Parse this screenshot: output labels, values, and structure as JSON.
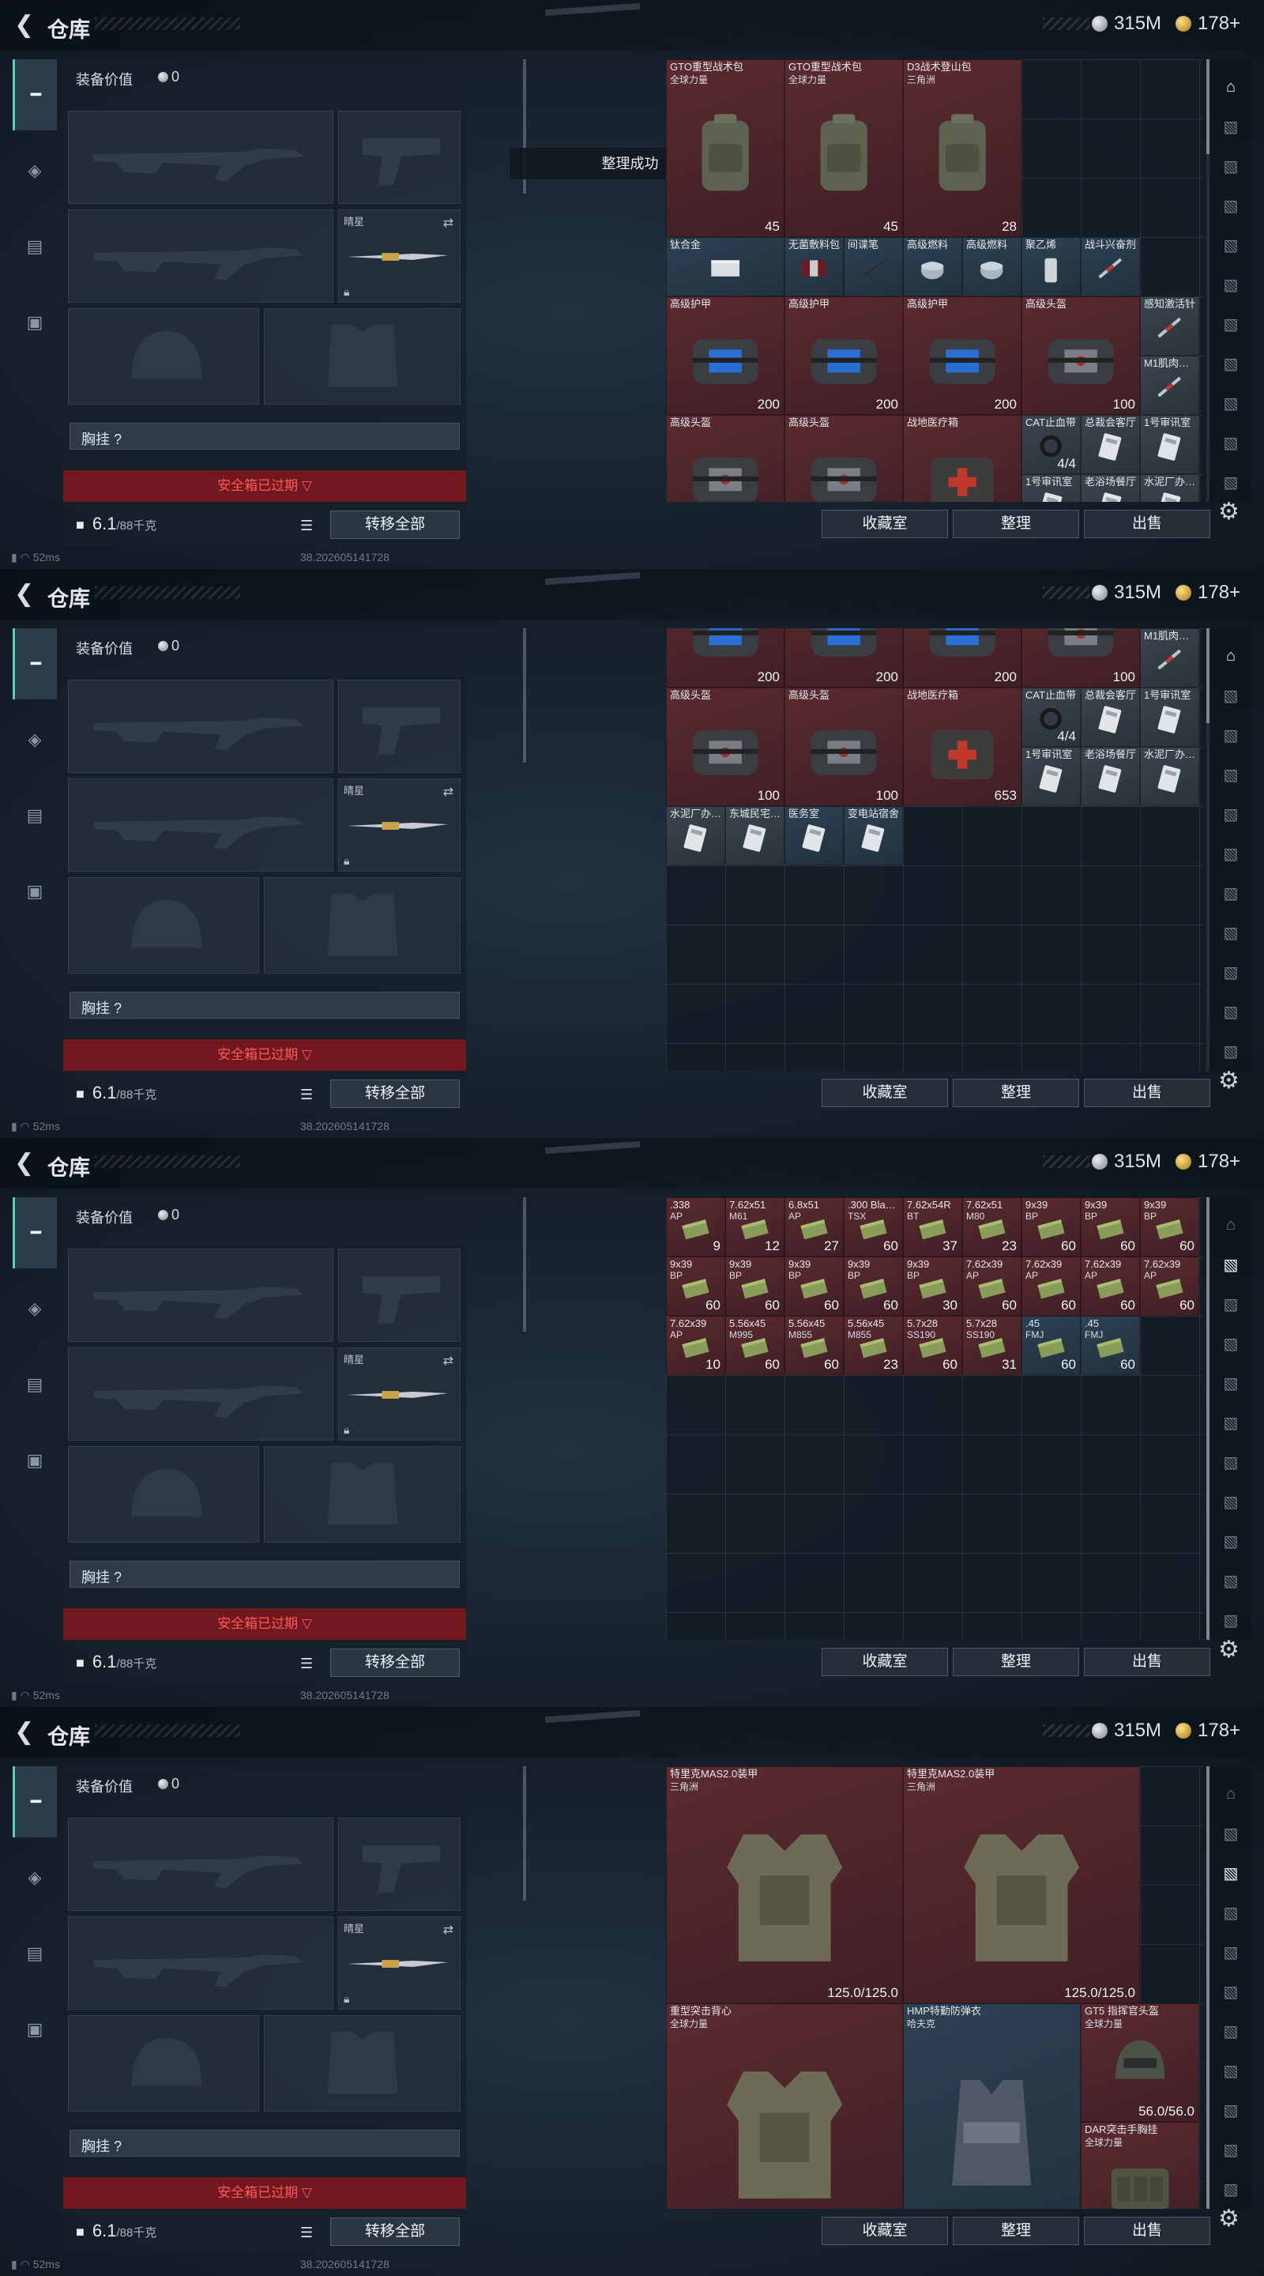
{
  "common": {
    "title": "仓库",
    "silver_value": "315M",
    "gold_value": "178+",
    "equip_title": "装备价值",
    "equip_value": "0",
    "secondary_label": "晴星",
    "chest_label": "胸挂 ?",
    "secure_label": "安全箱已过期 ▽",
    "weight_value": "6.1",
    "weight_unit": "/88千克",
    "transfer_label": "转移全部",
    "ping": "52ms",
    "version": "38.202605141728",
    "btn_collection": "收藏室",
    "btn_sort": "整理",
    "btn_sell": "出售",
    "colors": {
      "accent": "#5bd0b8",
      "alert_red": "#ff5a5a",
      "secure_bg": "#80161e"
    }
  },
  "panels": [
    {
      "toast": "整理成功",
      "items": [
        {
          "name": "GTO重型战术包",
          "sub": "全球力量",
          "val": "45",
          "c": 0,
          "r": 0,
          "w": 2,
          "h": 3,
          "color": "red",
          "icon": "backpack-icon"
        },
        {
          "name": "GTO重型战术包",
          "sub": "全球力量",
          "val": "45",
          "c": 2,
          "r": 0,
          "w": 2,
          "h": 3,
          "color": "red",
          "icon": "backpack-icon"
        },
        {
          "name": "D3战术登山包",
          "sub": "三角洲",
          "val": "28",
          "c": 4,
          "r": 0,
          "w": 2,
          "h": 3,
          "color": "red",
          "icon": "backpack-icon"
        },
        {
          "name": "钛合金",
          "c": 0,
          "r": 3,
          "w": 2,
          "h": 1,
          "color": "blue",
          "icon": "metal-plate-icon"
        },
        {
          "name": "无菌敷料包",
          "c": 2,
          "r": 3,
          "w": 1,
          "h": 1,
          "color": "blue",
          "icon": "bandage-icon"
        },
        {
          "name": "间谍笔",
          "c": 3,
          "r": 3,
          "w": 1,
          "h": 1,
          "color": "blue",
          "icon": "pen-icon"
        },
        {
          "name": "高级燃料",
          "c": 4,
          "r": 3,
          "w": 1,
          "h": 1,
          "color": "blue",
          "icon": "fuel-can-icon"
        },
        {
          "name": "高级燃料",
          "c": 5,
          "r": 3,
          "w": 1,
          "h": 1,
          "color": "blue",
          "icon": "fuel-can-icon"
        },
        {
          "name": "聚乙烯",
          "c": 6,
          "r": 3,
          "w": 1,
          "h": 1,
          "color": "blue",
          "icon": "bottle-icon"
        },
        {
          "name": "战斗兴奋剂",
          "c": 7,
          "r": 3,
          "w": 1,
          "h": 1,
          "color": "blue",
          "icon": "syringe-icon"
        },
        {
          "name": "高级护甲",
          "val": "200",
          "c": 0,
          "r": 4,
          "w": 2,
          "h": 2,
          "color": "red",
          "icon": "armor-case-icon"
        },
        {
          "name": "高级护甲",
          "val": "200",
          "c": 2,
          "r": 4,
          "w": 2,
          "h": 2,
          "color": "red",
          "icon": "armor-case-icon"
        },
        {
          "name": "高级护甲",
          "val": "200",
          "c": 4,
          "r": 4,
          "w": 2,
          "h": 2,
          "color": "red",
          "icon": "armor-case-icon"
        },
        {
          "name": "高级头盔",
          "val": "100",
          "c": 6,
          "r": 4,
          "w": 2,
          "h": 2,
          "color": "red",
          "icon": "helmet-case-icon"
        },
        {
          "name": "感知激活针",
          "c": 8,
          "r": 4,
          "w": 1,
          "h": 1,
          "color": "grey",
          "icon": "syringe-icon"
        },
        {
          "name": "M1肌肉…",
          "c": 8,
          "r": 5,
          "w": 1,
          "h": 1,
          "color": "grey",
          "icon": "syringe-icon"
        },
        {
          "name": "高级头盔",
          "val": "100",
          "c": 0,
          "r": 6,
          "w": 2,
          "h": 2,
          "color": "red",
          "icon": "helmet-case-icon"
        },
        {
          "name": "高级头盔",
          "val": "100",
          "c": 2,
          "r": 6,
          "w": 2,
          "h": 2,
          "color": "red",
          "icon": "helmet-case-icon"
        },
        {
          "name": "战地医疗箱",
          "val": "653",
          "c": 4,
          "r": 6,
          "w": 2,
          "h": 2,
          "color": "red",
          "icon": "medkit-icon"
        },
        {
          "name": "CAT止血带",
          "val": "4/4",
          "c": 6,
          "r": 6,
          "w": 1,
          "h": 1,
          "color": "grey",
          "icon": "tourniquet-icon"
        },
        {
          "name": "总裁会客厅",
          "c": 7,
          "r": 6,
          "w": 1,
          "h": 1,
          "color": "grey",
          "icon": "keycard-icon"
        },
        {
          "name": "1号审讯室",
          "c": 8,
          "r": 6,
          "w": 1,
          "h": 1,
          "color": "grey",
          "icon": "keycard-icon"
        },
        {
          "name": "1号审讯室",
          "c": 6,
          "r": 7,
          "w": 1,
          "h": 1,
          "color": "grey",
          "icon": "keycard-icon"
        },
        {
          "name": "老浴场餐厅",
          "c": 7,
          "r": 7,
          "w": 1,
          "h": 1,
          "color": "grey",
          "icon": "keycard-icon"
        },
        {
          "name": "水泥厂办…",
          "c": 8,
          "r": 7,
          "w": 1,
          "h": 1,
          "color": "grey",
          "icon": "keycard-icon"
        }
      ],
      "thumb_top": 0,
      "thumb_h": 120
    },
    {
      "items": [
        {
          "name": "",
          "val": "200",
          "c": 0,
          "r": -1,
          "w": 2,
          "h": 2,
          "color": "red",
          "icon": "armor-case-icon"
        },
        {
          "name": "",
          "val": "200",
          "c": 2,
          "r": -1,
          "w": 2,
          "h": 2,
          "color": "red",
          "icon": "armor-case-icon"
        },
        {
          "name": "",
          "val": "200",
          "c": 4,
          "r": -1,
          "w": 2,
          "h": 2,
          "color": "red",
          "icon": "armor-case-icon"
        },
        {
          "name": "",
          "val": "100",
          "c": 6,
          "r": -1,
          "w": 2,
          "h": 2,
          "color": "red",
          "icon": "helmet-case-icon"
        },
        {
          "name": "M1肌肉…",
          "c": 8,
          "r": 0,
          "w": 1,
          "h": 1,
          "color": "grey",
          "icon": "syringe-icon"
        },
        {
          "name": "高级头盔",
          "val": "100",
          "c": 0,
          "r": 1,
          "w": 2,
          "h": 2,
          "color": "red",
          "icon": "helmet-case-icon"
        },
        {
          "name": "高级头盔",
          "val": "100",
          "c": 2,
          "r": 1,
          "w": 2,
          "h": 2,
          "color": "red",
          "icon": "helmet-case-icon"
        },
        {
          "name": "战地医疗箱",
          "val": "653",
          "c": 4,
          "r": 1,
          "w": 2,
          "h": 2,
          "color": "red",
          "icon": "medkit-icon"
        },
        {
          "name": "CAT止血带",
          "val": "4/4",
          "c": 6,
          "r": 1,
          "w": 1,
          "h": 1,
          "color": "grey",
          "icon": "tourniquet-icon"
        },
        {
          "name": "总裁会客厅",
          "c": 7,
          "r": 1,
          "w": 1,
          "h": 1,
          "color": "grey",
          "icon": "keycard-icon"
        },
        {
          "name": "1号审讯室",
          "c": 8,
          "r": 1,
          "w": 1,
          "h": 1,
          "color": "grey",
          "icon": "keycard-icon"
        },
        {
          "name": "1号审讯室",
          "c": 6,
          "r": 2,
          "w": 1,
          "h": 1,
          "color": "grey",
          "icon": "keycard-icon"
        },
        {
          "name": "老浴场餐厅",
          "c": 7,
          "r": 2,
          "w": 1,
          "h": 1,
          "color": "grey",
          "icon": "keycard-icon"
        },
        {
          "name": "水泥厂办…",
          "c": 8,
          "r": 2,
          "w": 1,
          "h": 1,
          "color": "grey",
          "icon": "keycard-icon"
        },
        {
          "name": "水泥厂办…",
          "c": 0,
          "r": 3,
          "w": 1,
          "h": 1,
          "color": "grey",
          "icon": "keycard-icon"
        },
        {
          "name": "东城民宅…",
          "c": 1,
          "r": 3,
          "w": 1,
          "h": 1,
          "color": "grey",
          "icon": "keycard-icon"
        },
        {
          "name": "医务室",
          "c": 2,
          "r": 3,
          "w": 1,
          "h": 1,
          "color": "blue",
          "icon": "keycard-icon"
        },
        {
          "name": "变电站宿舍",
          "c": 3,
          "r": 3,
          "w": 1,
          "h": 1,
          "color": "blue",
          "icon": "keycard-icon"
        }
      ],
      "thumb_top": 0,
      "thumb_h": 120
    },
    {
      "items": [
        {
          "name": ".338",
          "sub": "AP",
          "val": "9",
          "c": 0,
          "r": 0,
          "w": 1,
          "h": 1,
          "color": "red",
          "icon": "ammo-box-icon"
        },
        {
          "name": "7.62x51",
          "sub": "M61",
          "val": "12",
          "c": 1,
          "r": 0,
          "w": 1,
          "h": 1,
          "color": "red",
          "icon": "ammo-box-icon"
        },
        {
          "name": "6.8x51",
          "sub": "AP",
          "val": "27",
          "c": 2,
          "r": 0,
          "w": 1,
          "h": 1,
          "color": "red",
          "icon": "ammo-box-icon"
        },
        {
          "name": ".300 Bla…",
          "sub": "TSX",
          "val": "60",
          "c": 3,
          "r": 0,
          "w": 1,
          "h": 1,
          "color": "red",
          "icon": "ammo-box-icon"
        },
        {
          "name": "7.62x54R",
          "sub": "BT",
          "val": "37",
          "c": 4,
          "r": 0,
          "w": 1,
          "h": 1,
          "color": "red",
          "icon": "ammo-box-icon"
        },
        {
          "name": "7.62x51",
          "sub": "M80",
          "val": "23",
          "c": 5,
          "r": 0,
          "w": 1,
          "h": 1,
          "color": "red",
          "icon": "ammo-box-icon"
        },
        {
          "name": "9x39",
          "sub": "BP",
          "val": "60",
          "c": 6,
          "r": 0,
          "w": 1,
          "h": 1,
          "color": "red",
          "icon": "ammo-box-icon"
        },
        {
          "name": "9x39",
          "sub": "BP",
          "val": "60",
          "c": 7,
          "r": 0,
          "w": 1,
          "h": 1,
          "color": "red",
          "icon": "ammo-box-icon"
        },
        {
          "name": "9x39",
          "sub": "BP",
          "val": "60",
          "c": 8,
          "r": 0,
          "w": 1,
          "h": 1,
          "color": "red",
          "icon": "ammo-box-icon"
        },
        {
          "name": "9x39",
          "sub": "BP",
          "val": "60",
          "c": 0,
          "r": 1,
          "w": 1,
          "h": 1,
          "color": "red",
          "icon": "ammo-box-icon"
        },
        {
          "name": "9x39",
          "sub": "BP",
          "val": "60",
          "c": 1,
          "r": 1,
          "w": 1,
          "h": 1,
          "color": "red",
          "icon": "ammo-box-icon"
        },
        {
          "name": "9x39",
          "sub": "BP",
          "val": "60",
          "c": 2,
          "r": 1,
          "w": 1,
          "h": 1,
          "color": "red",
          "icon": "ammo-box-icon"
        },
        {
          "name": "9x39",
          "sub": "BP",
          "val": "60",
          "c": 3,
          "r": 1,
          "w": 1,
          "h": 1,
          "color": "red",
          "icon": "ammo-box-icon"
        },
        {
          "name": "9x39",
          "sub": "BP",
          "val": "30",
          "c": 4,
          "r": 1,
          "w": 1,
          "h": 1,
          "color": "red",
          "icon": "ammo-box-icon"
        },
        {
          "name": "7.62x39",
          "sub": "AP",
          "val": "60",
          "c": 5,
          "r": 1,
          "w": 1,
          "h": 1,
          "color": "red",
          "icon": "ammo-box-icon"
        },
        {
          "name": "7.62x39",
          "sub": "AP",
          "val": "60",
          "c": 6,
          "r": 1,
          "w": 1,
          "h": 1,
          "color": "red",
          "icon": "ammo-box-icon"
        },
        {
          "name": "7.62x39",
          "sub": "AP",
          "val": "60",
          "c": 7,
          "r": 1,
          "w": 1,
          "h": 1,
          "color": "red",
          "icon": "ammo-box-icon"
        },
        {
          "name": "7.62x39",
          "sub": "AP",
          "val": "60",
          "c": 8,
          "r": 1,
          "w": 1,
          "h": 1,
          "color": "red",
          "icon": "ammo-box-icon"
        },
        {
          "name": "7.62x39",
          "sub": "AP",
          "val": "10",
          "c": 0,
          "r": 2,
          "w": 1,
          "h": 1,
          "color": "red",
          "icon": "ammo-box-icon"
        },
        {
          "name": "5.56x45",
          "sub": "M995",
          "val": "60",
          "c": 1,
          "r": 2,
          "w": 1,
          "h": 1,
          "color": "red",
          "icon": "ammo-box-icon"
        },
        {
          "name": "5.56x45",
          "sub": "M855",
          "val": "60",
          "c": 2,
          "r": 2,
          "w": 1,
          "h": 1,
          "color": "red",
          "icon": "ammo-box-icon"
        },
        {
          "name": "5.56x45",
          "sub": "M855",
          "val": "23",
          "c": 3,
          "r": 2,
          "w": 1,
          "h": 1,
          "color": "red",
          "icon": "ammo-box-icon"
        },
        {
          "name": "5.7x28",
          "sub": "SS190",
          "val": "60",
          "c": 4,
          "r": 2,
          "w": 1,
          "h": 1,
          "color": "red",
          "icon": "ammo-box-icon"
        },
        {
          "name": "5.7x28",
          "sub": "SS190",
          "val": "31",
          "c": 5,
          "r": 2,
          "w": 1,
          "h": 1,
          "color": "red",
          "icon": "ammo-box-icon"
        },
        {
          "name": ".45",
          "sub": "FMJ",
          "val": "60",
          "c": 6,
          "r": 2,
          "w": 1,
          "h": 1,
          "color": "blue",
          "icon": "ammo-box-icon"
        },
        {
          "name": ".45",
          "sub": "FMJ",
          "val": "60",
          "c": 7,
          "r": 2,
          "w": 1,
          "h": 1,
          "color": "blue",
          "icon": "ammo-box-icon"
        }
      ],
      "thumb_top": 0,
      "thumb_h": 560
    },
    {
      "items": [
        {
          "name": "特里克MAS2.0装甲",
          "sub": "三角洲",
          "val": "125.0/125.0",
          "c": 0,
          "r": 0,
          "w": 4,
          "h": 4,
          "color": "red",
          "icon": "body-armor-icon"
        },
        {
          "name": "特里克MAS2.0装甲",
          "sub": "三角洲",
          "val": "125.0/125.0",
          "c": 4,
          "r": 0,
          "w": 4,
          "h": 4,
          "color": "red",
          "icon": "body-armor-icon"
        },
        {
          "name": "重型突击背心",
          "sub": "全球力量",
          "c": 0,
          "r": 4,
          "w": 4,
          "h": 4,
          "color": "red",
          "icon": "body-armor-icon"
        },
        {
          "name": "HMP特勤防弹衣",
          "sub": "哈夫克",
          "c": 4,
          "r": 4,
          "w": 3,
          "h": 4,
          "color": "blue",
          "icon": "vest-icon"
        },
        {
          "name": "GT5 指挥官头盔",
          "sub": "全球力量",
          "val": "56.0/56.0",
          "c": 7,
          "r": 4,
          "w": 2,
          "h": 2,
          "color": "red",
          "icon": "helmet-icon"
        },
        {
          "name": "DAR突击手胸挂",
          "sub": "全球力量",
          "c": 7,
          "r": 6,
          "w": 2,
          "h": 2,
          "color": "red",
          "icon": "chest-rig-icon"
        }
      ],
      "thumb_top": 0,
      "thumb_h": 560
    }
  ]
}
